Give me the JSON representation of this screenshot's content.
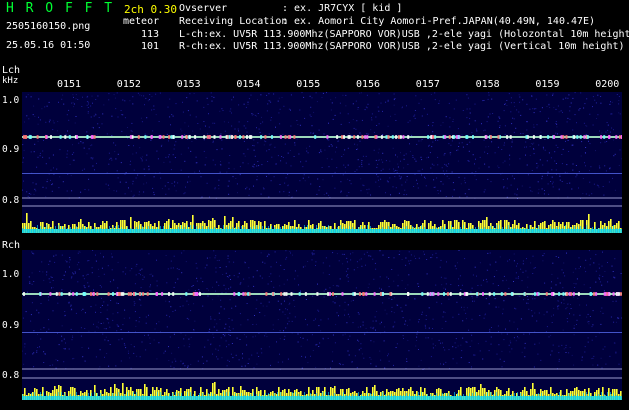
{
  "header": {
    "brand": "H R O F F T",
    "mode": "2ch 0.30",
    "filename": "2505160150.png",
    "meteor_label": "meteor",
    "lch_count": "113",
    "rch_count": "101",
    "datetime": "25.05.16 01:50",
    "observer_label": "Ovserver",
    "observer_value": ": ex. JR7CYX [ kid ]",
    "location_label": "Receiving Location",
    "location_value": ": ex. Aomori City Aomori-Pref.JAPAN(40.49N, 140.47E)",
    "lch_desc": "L-ch:ex. UV5R 113.900Mhz(SAPPORO VOR)USB ,2-ele yagi (Holozontal 10m height",
    "rch_desc": "R-ch:ex. UV5R 113.900Mhz(SAPPORO VOR)USB ,2-ele yagi (Vertical 10m height)"
  },
  "lch": {
    "label": "Lch",
    "unit": "kHz",
    "ticks": [
      "1.0",
      "0.9",
      "0.8"
    ]
  },
  "rch": {
    "label": "Rch",
    "ticks": [
      "1.0",
      "0.9",
      "0.8"
    ]
  },
  "time_labels": [
    "0151",
    "0152",
    "0153",
    "0154",
    "0155",
    "0156",
    "0157",
    "0158",
    "0159",
    "0200"
  ],
  "colors": {
    "background": "#000000",
    "waterfall_bg": "#00003c",
    "header_text": "#ffffff",
    "accent_yellow": "#ffff00",
    "accent_green": "#00ff33",
    "signal_line": "#b7ffd0",
    "meteor_bar": "#ffff33",
    "meteor_base": "#00d8ff"
  }
}
